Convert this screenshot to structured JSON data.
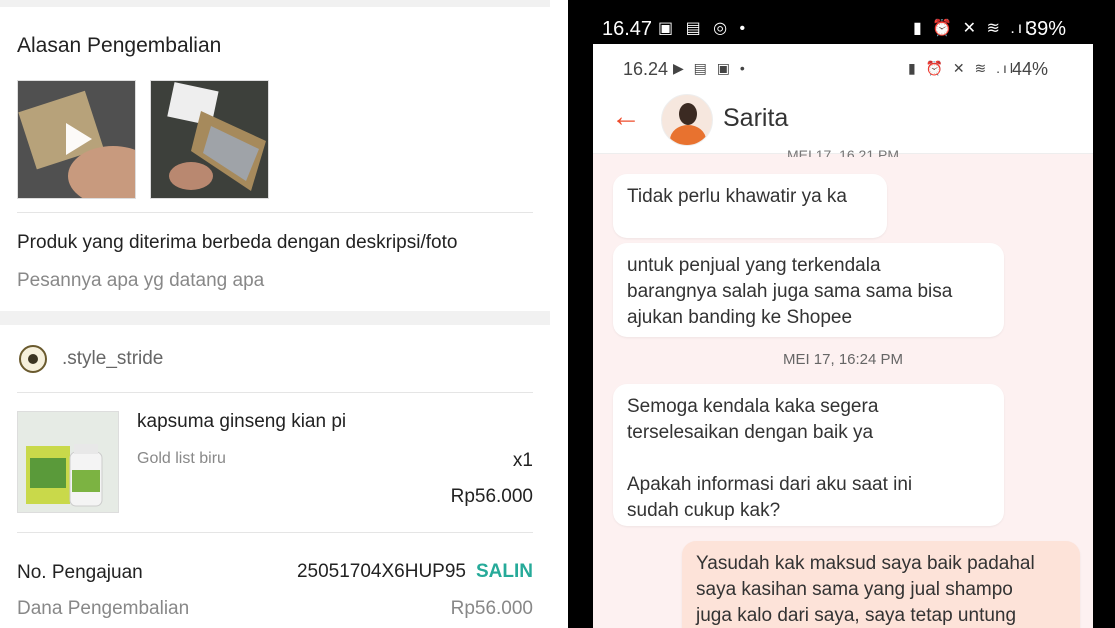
{
  "left": {
    "section_title": "Alasan Pengembalian",
    "reason": "Produk yang diterima berbeda dengan deskripsi/foto",
    "note": "Pesannya apa yg datang apa",
    "shop_name": ".style_stride",
    "product": {
      "name": "kapsuma ginseng kian pi",
      "variant": "Gold list biru",
      "qty": "x1",
      "price": "Rp56.000"
    },
    "request_no_label": "No. Pengajuan",
    "request_no": "25051704X6HUP95",
    "copy_label": "SALIN",
    "refund_label": "Dana Pengembalian",
    "refund_value": "Rp56.000"
  },
  "right": {
    "outer_status": {
      "time": "16.47",
      "battery": "39%"
    },
    "inner_status": {
      "time": "16.24",
      "battery": "44%"
    },
    "contact_name": "Sarita",
    "date_partial": "MEI 17, 16.21 PM",
    "date_separator": "MEI 17, 16:24 PM",
    "messages": [
      {
        "from": "agent",
        "text": "Tidak perlu khawatir  ya ka"
      },
      {
        "from": "agent",
        "text": "untuk penjual yang terkendala\nbarangnya salah juga sama sama bisa\najukan banding ke Shopee"
      },
      {
        "from": "agent",
        "text": "Semoga kendala kaka segera\nterselesaikan dengan baik ya\n\nApakah informasi dari aku saat ini\nsudah cukup kak?"
      },
      {
        "from": "user",
        "text": "Yasudah kak maksud saya baik padahal\nsaya kasihan sama yang jual shampo\njuga kalo dari saya, saya tetap untung"
      }
    ],
    "colors": {
      "accent": "#ee4d2d",
      "copy": "#26aa99",
      "chat_bg": "#fdf1f1",
      "my_bubble": "#fde3d9"
    }
  }
}
